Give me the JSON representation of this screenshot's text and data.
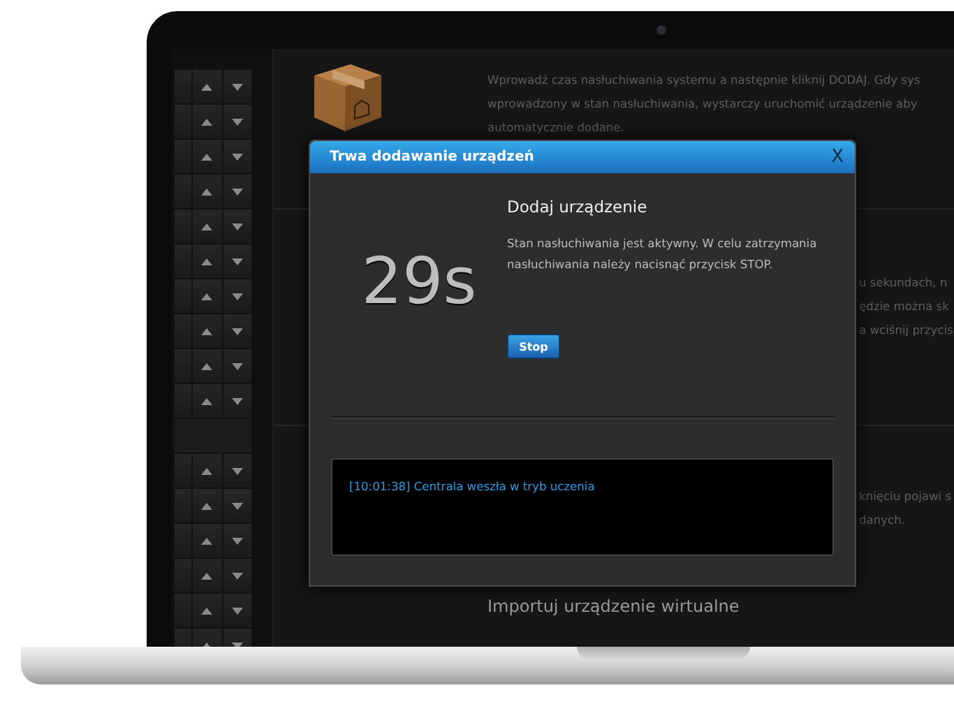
{
  "background": {
    "intro": [
      "Wprowadź czas nasłuchiwania systemu a następnie kliknij DODAJ. Gdy sys",
      "wprowadzony w stan nasłuchiwania, wystarczy uruchomić urządzenie aby",
      "automatycznie dodane."
    ],
    "fragments_1": [
      "u sekundach, n",
      "ędzie można sk",
      "a wciśnij przycis"
    ],
    "fragments_2": [
      "knięciu pojawi s",
      "danych."
    ],
    "import_heading": "Importuj urządzenie wirtualne"
  },
  "dialog": {
    "title": "Trwa dodawanie urządzeń",
    "close": "X",
    "countdown": "29s",
    "heading": "Dodaj urządzenie",
    "message": "Stan nasłuchiwania jest aktywny. W celu zatrzymania nasłuchiwania należy nacisnąć przycisk STOP.",
    "stop_button": "Stop",
    "log": [
      "[10:01:38] Centrala weszła w tryb uczenia"
    ]
  }
}
